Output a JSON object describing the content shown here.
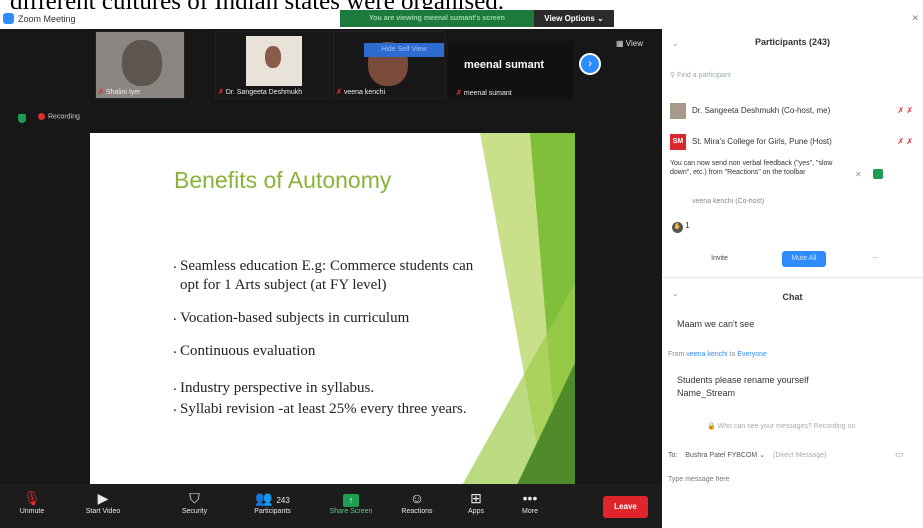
{
  "caption": "different cultures of Indian states were organised.",
  "window": {
    "title": "Zoom Meeting",
    "banner": "You are viewing meenal sumant's screen",
    "view_options": "View Options ⌄"
  },
  "thumbnails": [
    {
      "name": "Shalini Iyer",
      "color": "#8a8580"
    },
    {
      "name": "Dr. Sangeeta Deshmukh",
      "color": "#b9a48c"
    },
    {
      "name": "veena kenchi",
      "color": "#7a4a3a"
    },
    {
      "name": "meenal sumant",
      "color": "#111111"
    }
  ],
  "speaker_label": "meenal sumant",
  "hide_btn": "Hide Self View",
  "view_label": "View",
  "recording": "Recording",
  "slide": {
    "title": "Benefits of Autonomy",
    "bullets": [
      "Seamless education E.g: Commerce students can opt for 1 Arts subject (at FY level)",
      "Vocation-based subjects in curriculum",
      "Continuous evaluation",
      "Industry perspective in syllabus.",
      "Syllabi revision -at least 25% every three years."
    ]
  },
  "toolbar": {
    "unmute": "Unmute",
    "start_video": "Start Video",
    "security": "Security",
    "participants": "Participants",
    "participants_count": "243",
    "share": "Share Screen",
    "reactions": "Reactions",
    "apps": "Apps",
    "more": "More",
    "leave": "Leave"
  },
  "panel": {
    "title": "Participants (243)",
    "find": "Find a participant",
    "participants": [
      {
        "name": "Dr. Sangeeta Deshmukh (Co-host, me)",
        "initials": ""
      },
      {
        "name": "St. Mira's College for Girls, Pune (Host)",
        "initials": "SM"
      }
    ],
    "notice": "You can now send non verbal feedback (\"yes\", \"slow down\", etc.) from \"Reactions\" on the toolbar",
    "partial": "veena kenchi (Co-host)",
    "count_small": "1",
    "invite": "Invite",
    "mute_all": "Mute All",
    "chat_title": "Chat",
    "chat_msg1": "Maam we can't see",
    "from_prefix": "From",
    "from_name": "veena kenchi",
    "to_label": "to",
    "to_everyone": "Everyone",
    "chat_msg2": "Students please rename yourself Name_Stream",
    "hint": "Who can see your messages? Recording on",
    "to_prefix": "To:",
    "to_select": "Bushra Patel FYBCOM ⌄",
    "direct": "(Direct Message)",
    "type_placeholder": "Type message here"
  },
  "colors": {
    "accent": "#2d8cff",
    "leave": "#e0242b",
    "share": "#1e9e53",
    "slide_title": "#8ab33a"
  }
}
